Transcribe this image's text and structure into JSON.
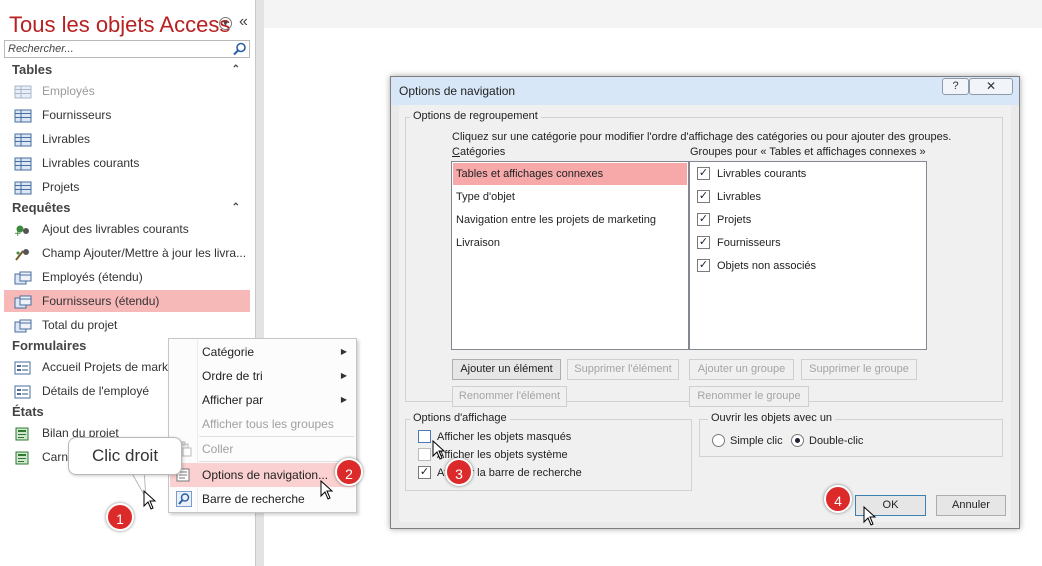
{
  "nav": {
    "title": "Tous les objets Access",
    "collapse_icon": "«",
    "dropdown_icon": "chevron-down-icon",
    "search_placeholder": "Rechercher...",
    "groups": {
      "tables": "Tables",
      "requetes": "Requêtes",
      "formulaires": "Formulaires",
      "etats": "États"
    },
    "tables": [
      "Employés",
      "Fournisseurs",
      "Livrables",
      "Livrables courants",
      "Projets"
    ],
    "requetes": [
      "Ajout des livrables courants",
      "Champ Ajouter/Mettre à jour les livra...",
      "Employés (étendu)",
      "Fournisseurs (étendu)",
      "Total du projet"
    ],
    "formulaires": [
      "Accueil Projets de market",
      "Détails de l'employé"
    ],
    "etats": [
      "Bilan du projet",
      "Carne"
    ]
  },
  "context_menu": {
    "categorie": "Catégorie",
    "ordre": "Ordre de tri",
    "afficher_par": "Afficher par",
    "afficher_tous": "Afficher tous les groupes",
    "coller": "Coller",
    "options": "Options de navigation...",
    "barre": "Barre de recherche"
  },
  "callouts": {
    "bubble": "Clic droit",
    "b1": "1",
    "b2": "2",
    "b3": "3",
    "b4": "4"
  },
  "dialog": {
    "title": "Options de navigation",
    "help": "?",
    "close": "✕",
    "regroupement_legend": "Options de regroupement",
    "instruction": "Cliquez sur une catégorie pour modifier l'ordre d'affichage des catégories ou pour ajouter des groupes.",
    "categories_label": "Catégories",
    "groups_label": "Groupes pour « Tables et affichages connexes »",
    "categories": [
      "Tables et affichages connexes",
      "Type d'objet",
      "Navigation entre les projets de marketing",
      "Livraison"
    ],
    "groups": [
      "Livrables courants",
      "Livrables",
      "Projets",
      "Fournisseurs",
      "Objets non associés"
    ],
    "btn_ajouter_element": "Ajouter un élément",
    "btn_supprimer_element": "Supprimer l'élément",
    "btn_renommer_element": "Renommer l'élément",
    "btn_ajouter_groupe": "Ajouter un groupe",
    "btn_supprimer_groupe": "Supprimer le groupe",
    "btn_renommer_groupe": "Renommer le groupe",
    "affichage_legend": "Options d'affichage",
    "chk_masques": "Afficher les objets masqués",
    "chk_systeme": "Afficher les objets système",
    "chk_recherche": "Afficher la barre de recherche",
    "ouvrir_legend": "Ouvrir les objets avec un",
    "radio_simple": "Simple clic",
    "radio_double": "Double-clic",
    "ok": "OK",
    "annuler": "Annuler"
  },
  "colors": {
    "accent": "#b72121",
    "selection": "#f7b8b8",
    "badge": "#dc2a2a"
  }
}
